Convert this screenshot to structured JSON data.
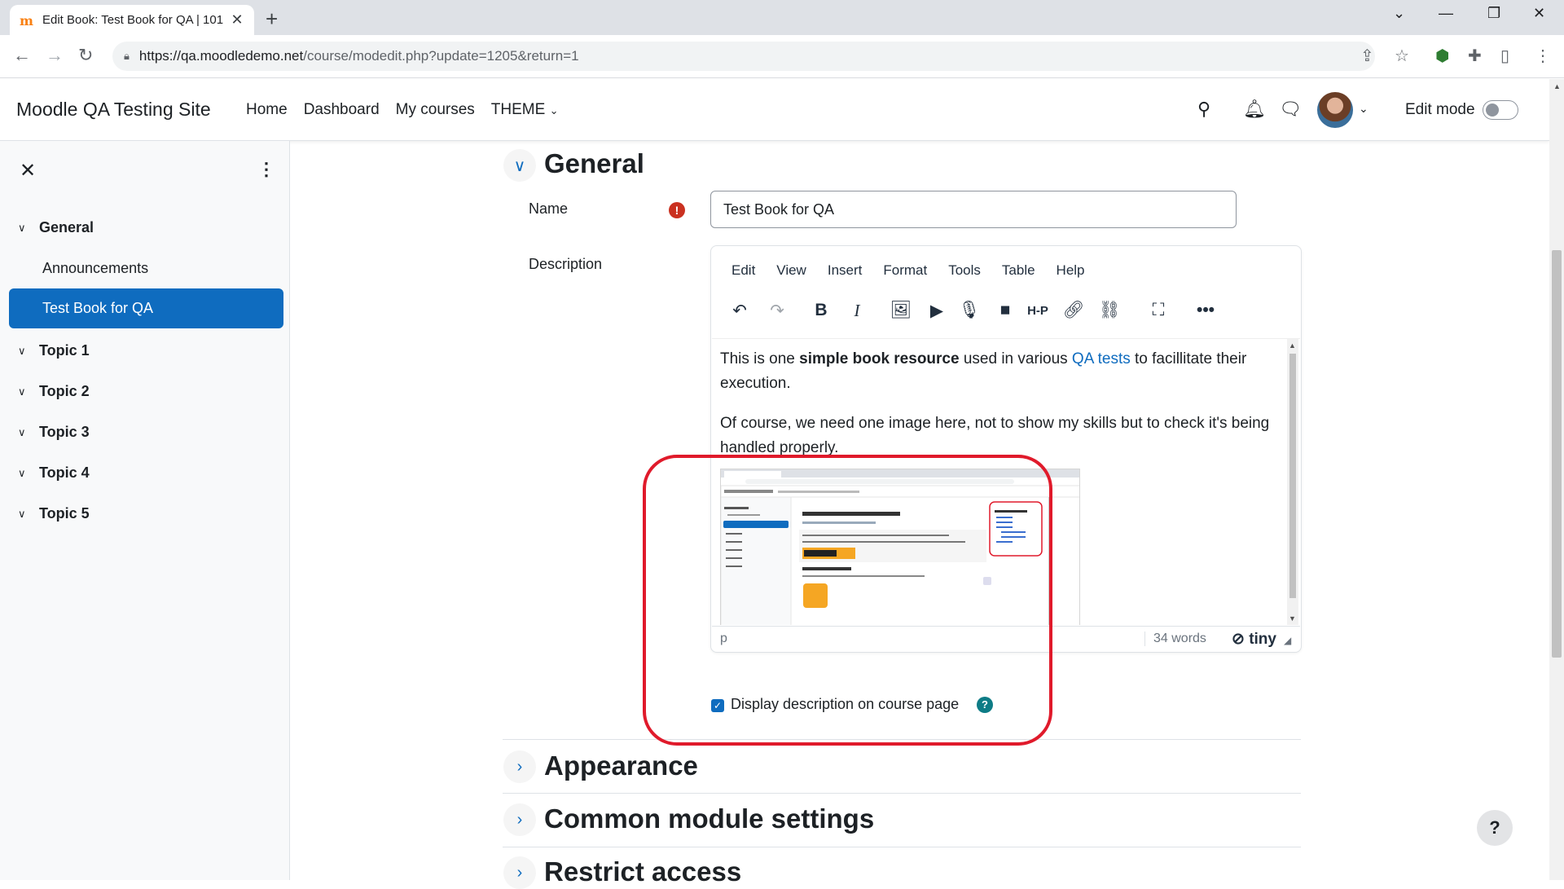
{
  "browser": {
    "tab_title": "Edit Book: Test Book for QA | 101",
    "url_host": "https://qa.moodledemo.net",
    "url_path": "/course/modedit.php?update=1205&return=1"
  },
  "header": {
    "site_name": "Moodle QA Testing Site",
    "nav": [
      "Home",
      "Dashboard",
      "My courses",
      "THEME"
    ],
    "edit_mode_label": "Edit mode",
    "edit_mode_on": false
  },
  "drawer": {
    "sections": [
      {
        "label": "General",
        "expanded": true
      },
      {
        "label": "Topic 1",
        "expanded": true
      },
      {
        "label": "Topic 2",
        "expanded": true
      },
      {
        "label": "Topic 3",
        "expanded": true
      },
      {
        "label": "Topic 4",
        "expanded": true
      },
      {
        "label": "Topic 5",
        "expanded": true
      }
    ],
    "items": [
      "Announcements",
      "Test Book for QA"
    ],
    "active_item": "Test Book for QA"
  },
  "form": {
    "general_title": "General",
    "name_label": "Name",
    "name_value": "Test Book for QA",
    "description_label": "Description",
    "editor_menu": [
      "Edit",
      "View",
      "Insert",
      "Format",
      "Tools",
      "Table",
      "Help"
    ],
    "content": {
      "p1_pre": "This is one ",
      "p1_bold": "simple book resource",
      "p1_mid": " used in various ",
      "p1_link": "QA tests",
      "p1_post": " to facillitate their execution.",
      "p2": "Of course, we need one image here, not to show my skills but to check it's being handled properly."
    },
    "status_path": "p",
    "word_count": "34 words",
    "tiny_brand": "tiny",
    "display_desc_label": "Display description on course page",
    "display_desc_checked": true,
    "sections_collapsed": [
      "Appearance",
      "Common module settings",
      "Restrict access"
    ]
  },
  "colors": {
    "primary": "#0f6cbf",
    "highlight": "#e01a2b",
    "required": "#ca3120"
  }
}
